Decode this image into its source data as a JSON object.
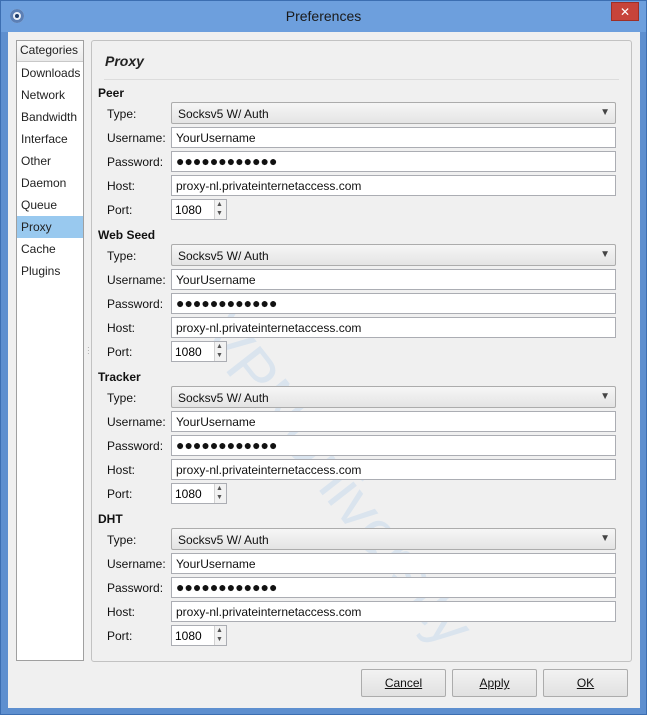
{
  "window": {
    "title": "Preferences",
    "close_glyph": "✕"
  },
  "sidebar": {
    "header": "Categories",
    "items": [
      "Downloads",
      "Network",
      "Bandwidth",
      "Interface",
      "Other",
      "Daemon",
      "Queue",
      "Proxy",
      "Cache",
      "Plugins"
    ],
    "selected": "Proxy"
  },
  "panel": {
    "title": "Proxy"
  },
  "labels": {
    "type": "Type:",
    "username": "Username:",
    "password": "Password:",
    "host": "Host:",
    "port": "Port:"
  },
  "sections": [
    {
      "title": "Peer",
      "type": "Socksv5 W/ Auth",
      "username": "YourUsername",
      "password": "●●●●●●●●●●●●",
      "host": "proxy-nl.privateinternetaccess.com",
      "port": "1080"
    },
    {
      "title": "Web Seed",
      "type": "Socksv5 W/ Auth",
      "username": "YourUsername",
      "password": "●●●●●●●●●●●●",
      "host": "proxy-nl.privateinternetaccess.com",
      "port": "1080"
    },
    {
      "title": "Tracker",
      "type": "Socksv5 W/ Auth",
      "username": "YourUsername",
      "password": "●●●●●●●●●●●●",
      "host": "proxy-nl.privateinternetaccess.com",
      "port": "1080"
    },
    {
      "title": "DHT",
      "type": "Socksv5 W/ Auth",
      "username": "YourUsername",
      "password": "●●●●●●●●●●●●",
      "host": "proxy-nl.privateinternetaccess.com",
      "port": "1080"
    }
  ],
  "buttons": {
    "cancel": "Cancel",
    "apply": "Apply",
    "ok": "OK"
  },
  "watermark": "VPNUniversity",
  "icons": {
    "combo_arrow": "▼",
    "spin_up": "▲",
    "spin_down": "▼"
  }
}
